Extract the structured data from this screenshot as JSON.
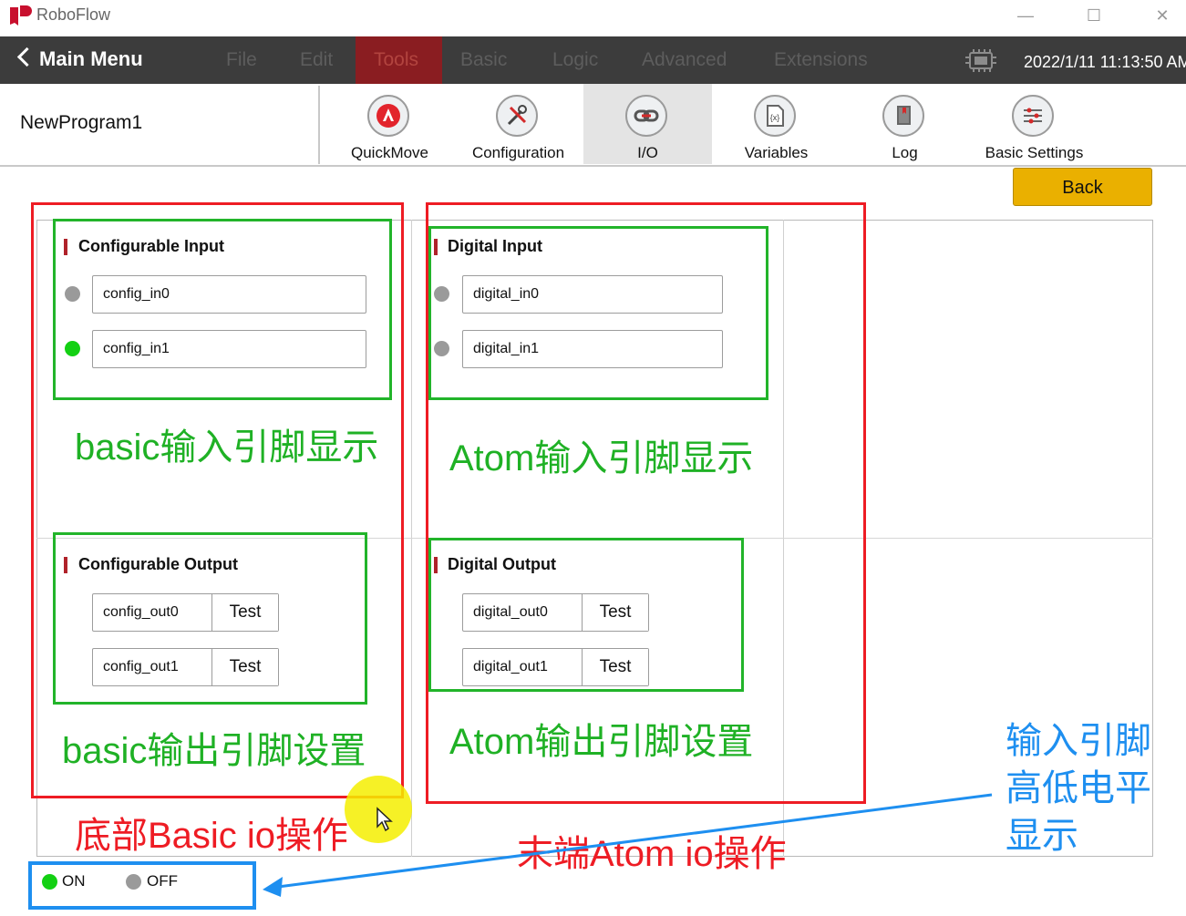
{
  "app": {
    "title": "RoboFlow"
  },
  "menu": {
    "main_menu_label": "Main Menu",
    "items": [
      "File",
      "Edit",
      "Tools",
      "Basic",
      "Logic",
      "Advanced",
      "Extensions"
    ],
    "active": "Tools",
    "datetime": "2022/1/11 11:13:50 AM"
  },
  "toolbar": {
    "program_name": "NewProgram1",
    "tools": [
      {
        "label": "QuickMove",
        "icon": "quickmove-icon"
      },
      {
        "label": "Configuration",
        "icon": "configuration-tools-icon"
      },
      {
        "label": "I/O",
        "icon": "io-link-icon"
      },
      {
        "label": "Variables",
        "icon": "variables-icon"
      },
      {
        "label": "Log",
        "icon": "log-book-icon"
      },
      {
        "label": "Basic Settings",
        "icon": "sliders-icon"
      }
    ],
    "active_tool": "I/O",
    "back_label": "Back"
  },
  "io": {
    "configurable_input": {
      "title": "Configurable Input",
      "pins": [
        {
          "name": "config_in0",
          "state": "off"
        },
        {
          "name": "config_in1",
          "state": "on"
        }
      ]
    },
    "digital_input": {
      "title": "Digital Input",
      "pins": [
        {
          "name": "digital_in0",
          "state": "off"
        },
        {
          "name": "digital_in1",
          "state": "off"
        }
      ]
    },
    "configurable_output": {
      "title": "Configurable Output",
      "pins": [
        {
          "name": "config_out0",
          "button": "Test"
        },
        {
          "name": "config_out1",
          "button": "Test"
        }
      ]
    },
    "digital_output": {
      "title": "Digital Output",
      "pins": [
        {
          "name": "digital_out0",
          "button": "Test"
        },
        {
          "name": "digital_out1",
          "button": "Test"
        }
      ]
    }
  },
  "legend": {
    "on": "ON",
    "off": "OFF"
  },
  "annotations": {
    "basic_input": "basic输入引脚显示",
    "atom_input": "Atom输入引脚显示",
    "basic_output": "basic输出引脚设置",
    "atom_output": "Atom输出引脚设置",
    "basic_io": "底部Basic io操作",
    "atom_io": "末端Atom io操作",
    "level_display": [
      "输入引脚",
      "高低电平",
      "显示"
    ]
  },
  "colors": {
    "menubar": "#3c3c3c",
    "active_menu": "#8a1d21",
    "back_button": "#eab000",
    "led_on": "#13d013",
    "led_off": "#9a9a9a",
    "annotation_red": "#ee1c24",
    "annotation_green": "#1fb125",
    "annotation_blue": "#1e8ff0"
  }
}
